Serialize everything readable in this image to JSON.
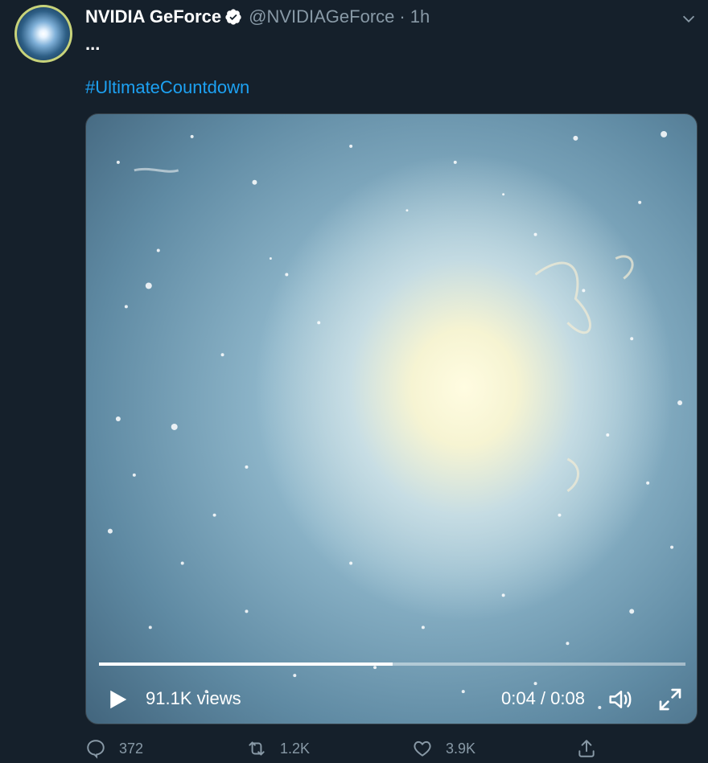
{
  "tweet": {
    "display_name": "NVIDIA GeForce",
    "handle": "@NVIDIAGeForce",
    "separator": "·",
    "time": "1h",
    "text": "...",
    "hashtag": "#UltimateCountdown"
  },
  "video": {
    "views": "91.1K views",
    "timecode": "0:04 / 0:08",
    "progress": 0.5
  },
  "actions": {
    "replies": "372",
    "retweets": "1.2K",
    "likes": "3.9K"
  },
  "colors": {
    "background": "#15202b",
    "link": "#1da1f2",
    "secondary_text": "#8899a6"
  }
}
